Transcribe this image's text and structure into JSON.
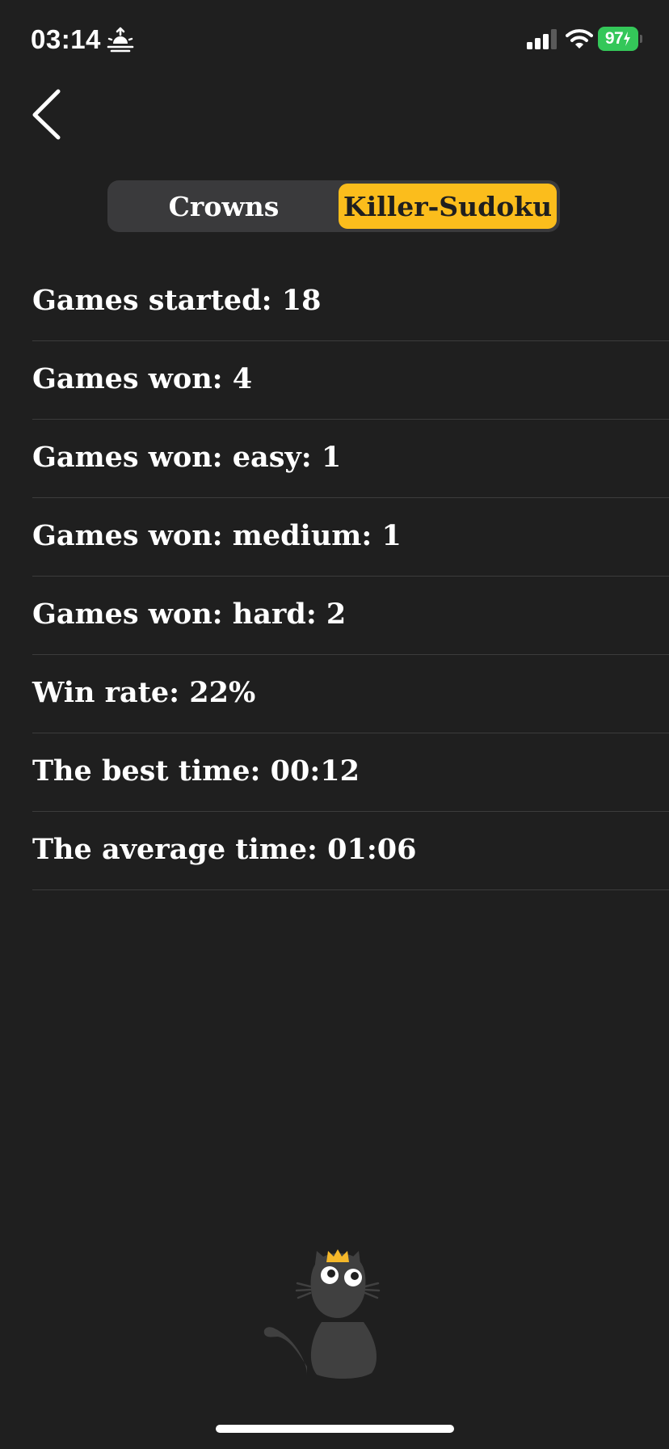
{
  "status_bar": {
    "time": "03:14",
    "battery": "97",
    "icons": [
      "sunrise-icon",
      "cellular-signal-icon",
      "wifi-icon",
      "battery-charging-icon"
    ]
  },
  "nav": {
    "back_icon": "chevron-left-icon"
  },
  "tabs": [
    {
      "label": "Crowns",
      "selected": false
    },
    {
      "label": "Killer-Sudoku",
      "selected": true
    }
  ],
  "stats": [
    "Games started: 18",
    "Games won: 4",
    "Games won: easy: 1",
    "Games won: medium: 1",
    "Games won: hard: 2",
    "Win rate: 22%",
    "The best time: 00:12",
    "The average time: 01:06"
  ],
  "colors": {
    "background": "#1f1f1f",
    "accent": "#fbbd1c",
    "segment_bg": "#3a3a3c",
    "battery": "#34c759",
    "divider": "#3c3c3c"
  },
  "mascot": "cat-with-crown-icon"
}
